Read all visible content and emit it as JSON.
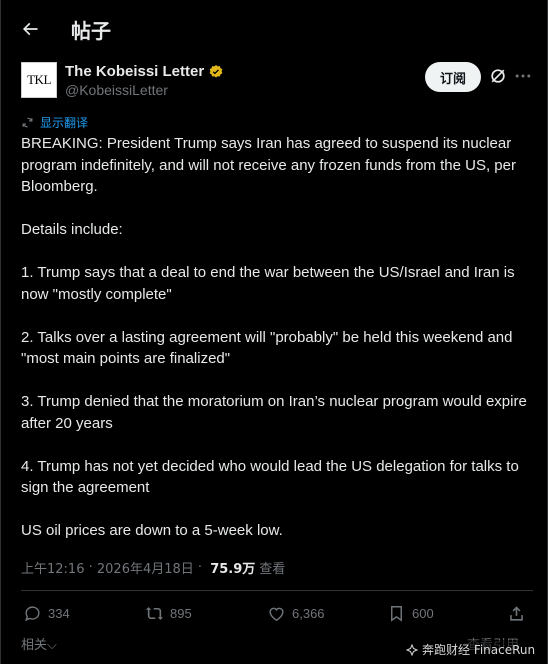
{
  "header": {
    "title": "帖子",
    "back_icon": "arrow-left-icon"
  },
  "author": {
    "avatar_text": "TKL",
    "name": "The Kobeissi Letter",
    "handle": "@KobeissiLetter",
    "verified_color": "#e2b719"
  },
  "actions_top": {
    "subscribe_label": "订阅"
  },
  "translate": {
    "label": "显示翻译"
  },
  "tweet": {
    "paragraphs": [
      "BREAKING: President Trump says Iran has agreed to suspend its nuclear program indefinitely, and will not receive any frozen funds from the US, per Bloomberg.",
      "Details include:",
      "1. Trump says that a deal to end the war between the US/Israel and Iran is now \"mostly complete\"",
      "2. Talks over a lasting agreement will \"probably\" be held this weekend and \"most main points are finalized\"",
      "3. Trump denied that the moratorium on Iran’s nuclear program would expire after 20 years",
      "4. Trump has not yet decided who would lead the US delegation for talks to sign the agreement",
      "US oil prices are down to a 5-week low."
    ]
  },
  "meta": {
    "time": "上午12:16",
    "separator": " · ",
    "date": "2026年4月18日",
    "views_count": "75.9万",
    "views_label": "查看"
  },
  "stats": {
    "replies": "334",
    "reposts": "895",
    "likes": "6,366",
    "bookmarks": "600"
  },
  "footer": {
    "related": "相关",
    "quotes": "查看引用"
  },
  "watermark": {
    "text": "奔跑财经 FinaceRun"
  },
  "colors": {
    "accent": "#1d9bf0",
    "muted": "#71767b",
    "text": "#e7e9ea",
    "background": "#000000"
  }
}
